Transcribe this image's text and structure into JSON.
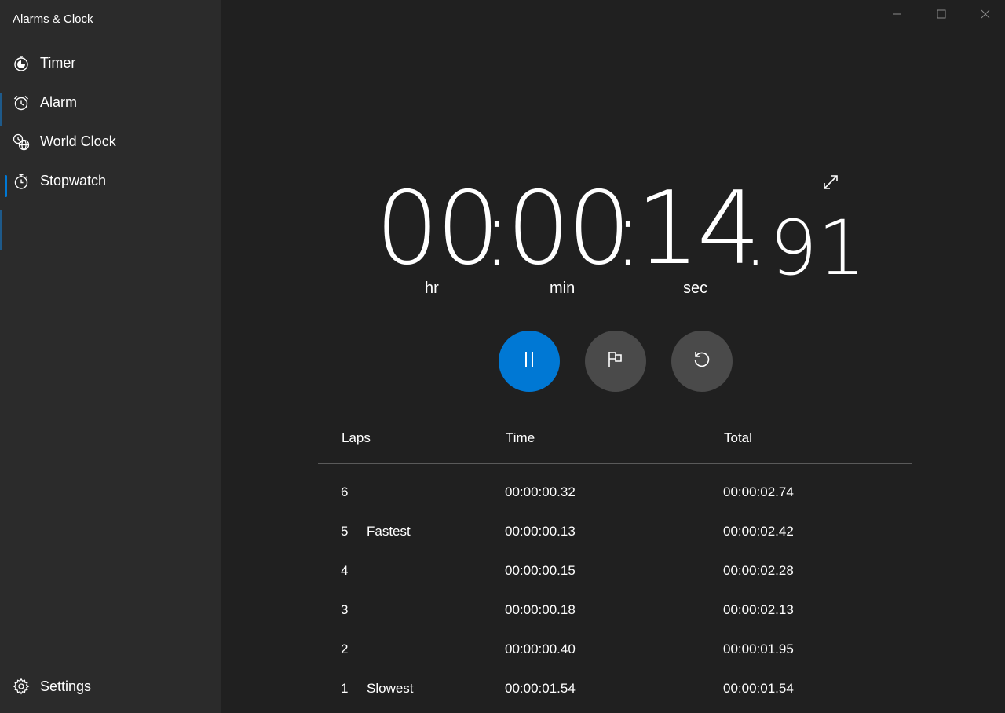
{
  "app": {
    "title": "Alarms & Clock"
  },
  "colors": {
    "accent": "#0078d4",
    "sidebar": "#2b2b2b",
    "background": "#202020",
    "secondary_button": "#4a4a4a"
  },
  "sidebar": {
    "items": [
      {
        "label": "Timer",
        "icon": "timer-icon",
        "selected": false
      },
      {
        "label": "Alarm",
        "icon": "alarm-clock-icon",
        "selected": false
      },
      {
        "label": "World Clock",
        "icon": "world-clock-icon",
        "selected": false
      },
      {
        "label": "Stopwatch",
        "icon": "stopwatch-icon",
        "selected": true
      }
    ],
    "settings_label": "Settings"
  },
  "window_controls": [
    "minimize-icon",
    "maximize-icon",
    "close-icon"
  ],
  "stopwatch": {
    "hours": "00",
    "minutes": "00",
    "seconds": "14",
    "separator": ":",
    "decimal": ".",
    "hundredths": "91",
    "unit_hr": "hr",
    "unit_min": "min",
    "unit_sec": "sec",
    "state": "running"
  },
  "laps": {
    "headers": {
      "laps": "Laps",
      "time": "Time",
      "total": "Total"
    },
    "rows": [
      {
        "num": "6",
        "note": "",
        "time": "00:00:00.32",
        "total": "00:00:02.74"
      },
      {
        "num": "5",
        "note": "Fastest",
        "time": "00:00:00.13",
        "total": "00:00:02.42"
      },
      {
        "num": "4",
        "note": "",
        "time": "00:00:00.15",
        "total": "00:00:02.28"
      },
      {
        "num": "3",
        "note": "",
        "time": "00:00:00.18",
        "total": "00:00:02.13"
      },
      {
        "num": "2",
        "note": "",
        "time": "00:00:00.40",
        "total": "00:00:01.95"
      },
      {
        "num": "1",
        "note": "Slowest",
        "time": "00:00:01.54",
        "total": "00:00:01.54"
      }
    ]
  }
}
